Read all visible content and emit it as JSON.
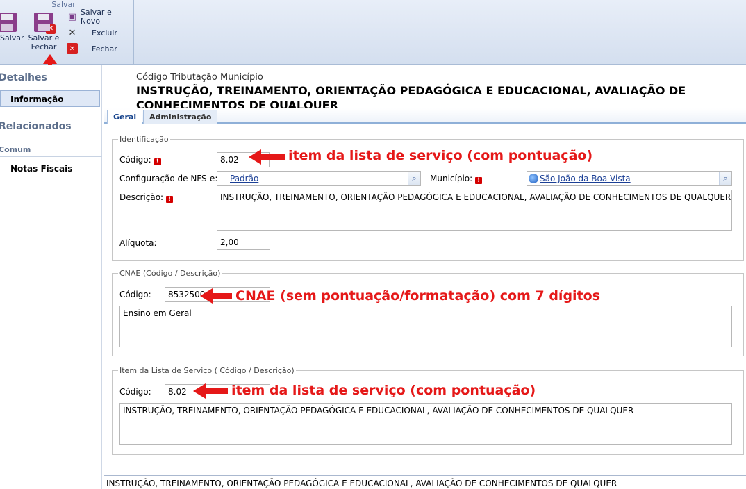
{
  "ribbon": {
    "group_title": "Salvar",
    "save": "Salvar",
    "save_close": "Salvar e Fechar",
    "save_new": "Salvar e Novo",
    "delete": "Excluir",
    "close": "Fechar"
  },
  "sidebar": {
    "details_header": "Detalhes",
    "info_item": "Informação",
    "related_header": "Relacionados",
    "common_header": "Comum",
    "invoices_item": "Notas Fiscais"
  },
  "header": {
    "entity_type": "Código Tributação Município",
    "entity_name": "INSTRUÇÃO, TREINAMENTO, ORIENTAÇÃO PEDAGÓGICA E EDUCACIONAL, AVALIAÇÃO DE CONHECIMENTOS DE QUALQUER"
  },
  "tabs": [
    "Geral",
    "Administração"
  ],
  "identificacao": {
    "legend": "Identificação",
    "codigo_label": "Código:",
    "codigo_value": "8.02",
    "config_label": "Configuração de NFS-e:",
    "config_value": "Padrão",
    "municipio_label": "Município:",
    "municipio_value": "São João da Boa Vista",
    "descricao_label": "Descrição:",
    "descricao_value": "INSTRUÇÃO, TREINAMENTO, ORIENTAÇÃO PEDAGÓGICA E EDUCACIONAL, AVALIAÇÃO DE CONHECIMENTOS DE QUALQUER",
    "aliquota_label": "Alíquota:",
    "aliquota_value": "2,00"
  },
  "cnae": {
    "legend": "CNAE (Código / Descrição)",
    "codigo_label": "Código:",
    "codigo_value": "8532500",
    "descricao_value": "Ensino em Geral"
  },
  "item_lista": {
    "legend": "Item da Lista de Serviço ( Código / Descrição)",
    "codigo_label": "Código:",
    "codigo_value": "8.02",
    "descricao_value": "INSTRUÇÃO, TREINAMENTO, ORIENTAÇÃO PEDAGÓGICA E EDUCACIONAL, AVALIAÇÃO DE CONHECIMENTOS DE QUALQUER"
  },
  "annotations": {
    "a1": "item da lista de serviço (com pontuação)",
    "a2": "CNAE (sem pontuação/formatação) com 7 dígitos",
    "a3": "item da lista de serviço (com pontuação)"
  },
  "footer_text": "INSTRUÇÃO, TREINAMENTO, ORIENTAÇÃO PEDAGÓGICA E EDUCACIONAL, AVALIAÇÃO DE CONHECIMENTOS DE QUALQUER",
  "colors": {
    "annotation": "#e51818",
    "link": "#1b3f95",
    "required": "#d40000"
  }
}
